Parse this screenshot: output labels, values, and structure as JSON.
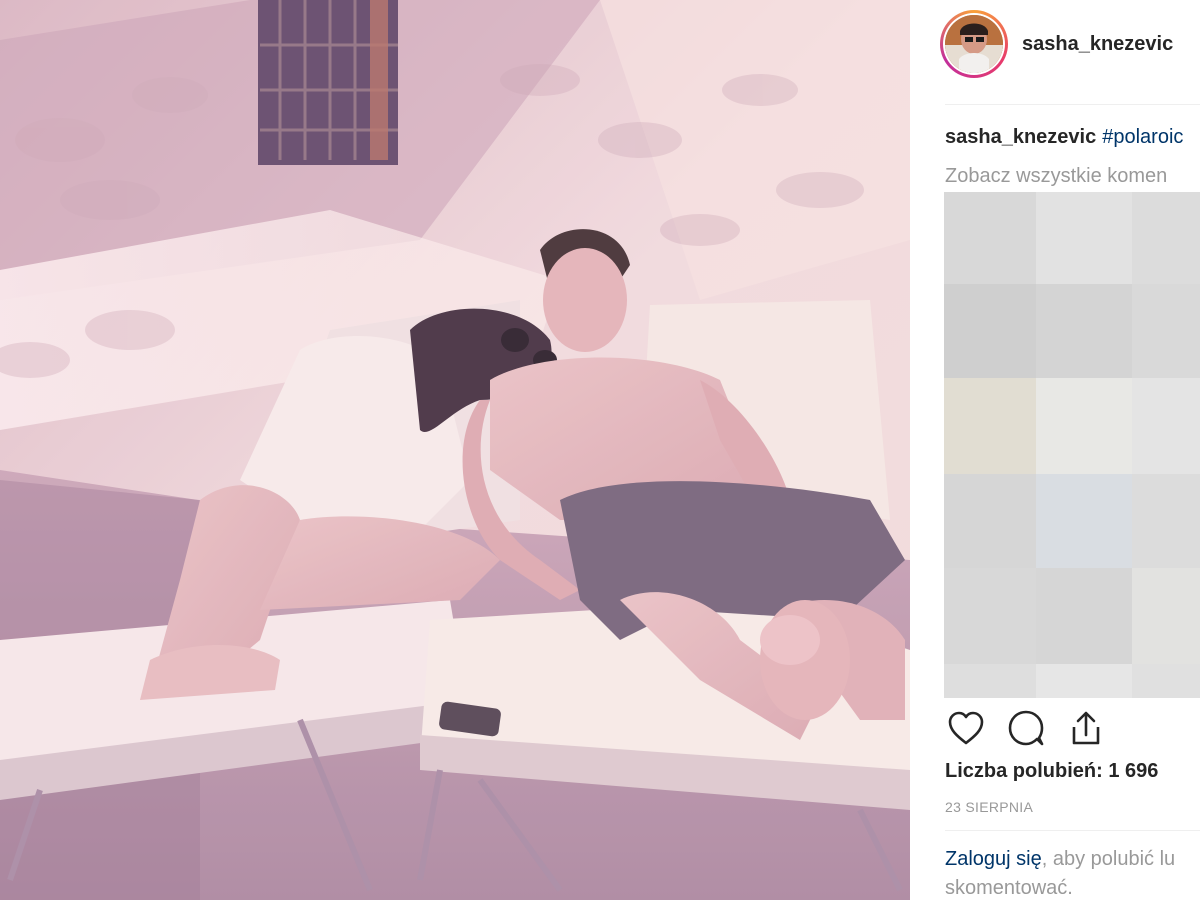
{
  "post": {
    "username": "sasha_knezevic",
    "caption_author": "sasha_knezevic",
    "caption_hashtag": "#polaroic",
    "view_all_comments": "Zobacz wszystkie komen",
    "likes": "Liczba polubień: 1 696",
    "date": "23 SIERPNIA",
    "login_link": "Zaloguj się",
    "login_text_1": ", aby polubić lu",
    "login_text_2": "skomentować."
  },
  "icons": {
    "like": "heart-icon",
    "comment": "comment-icon",
    "share": "share-icon"
  },
  "colors": {
    "link": "#003569",
    "muted": "#999999",
    "text": "#262626"
  },
  "blurred_comment_tiles": [
    "#d8d8d8",
    "#e2e2e2",
    "#dcdcdc",
    "#cfcfcf",
    "#d4d4d4",
    "#d9d9d9",
    "#e1ddd2",
    "#e8e8e5",
    "#e4e4e4",
    "#d6d6d6",
    "#d9dde2",
    "#dcdcdc",
    "#d8d8d8",
    "#d6d6d6",
    "#e2e2e0",
    "#dedede",
    "#e6e6e6",
    "#e0e0e0"
  ]
}
